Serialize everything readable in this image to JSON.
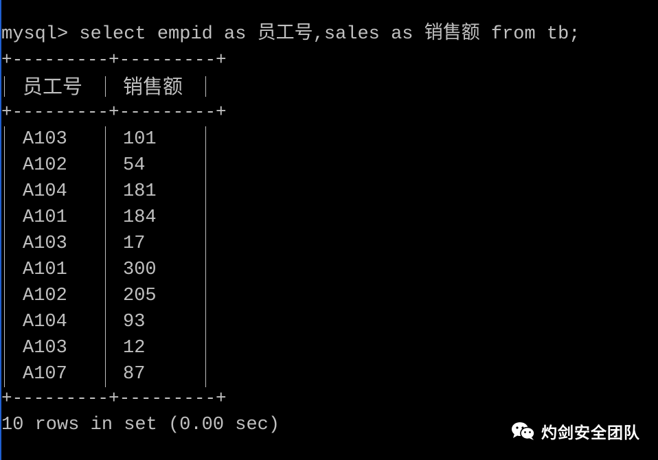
{
  "terminal": {
    "prompt": "mysql> ",
    "command": "select empid as 员工号,sales as 销售额 from tb;",
    "result_summary": "10 rows in set (0.00 sec)"
  },
  "table": {
    "border": "+---------+---------+",
    "columns": [
      "员工号",
      "销售额"
    ],
    "rows": [
      [
        "A103",
        "101"
      ],
      [
        "A102",
        "54"
      ],
      [
        "A104",
        "181"
      ],
      [
        "A101",
        "184"
      ],
      [
        "A103",
        "17"
      ],
      [
        "A101",
        "300"
      ],
      [
        "A102",
        "205"
      ],
      [
        "A104",
        "93"
      ],
      [
        "A103",
        "12"
      ],
      [
        "A107",
        "87"
      ]
    ]
  },
  "watermark": {
    "icon": "wechat-icon",
    "text": "灼剑安全团队"
  },
  "colors": {
    "background": "#000000",
    "text": "#c0c0c0",
    "edge_strip": "#1f5fd0",
    "watermark": "#ffffff"
  }
}
